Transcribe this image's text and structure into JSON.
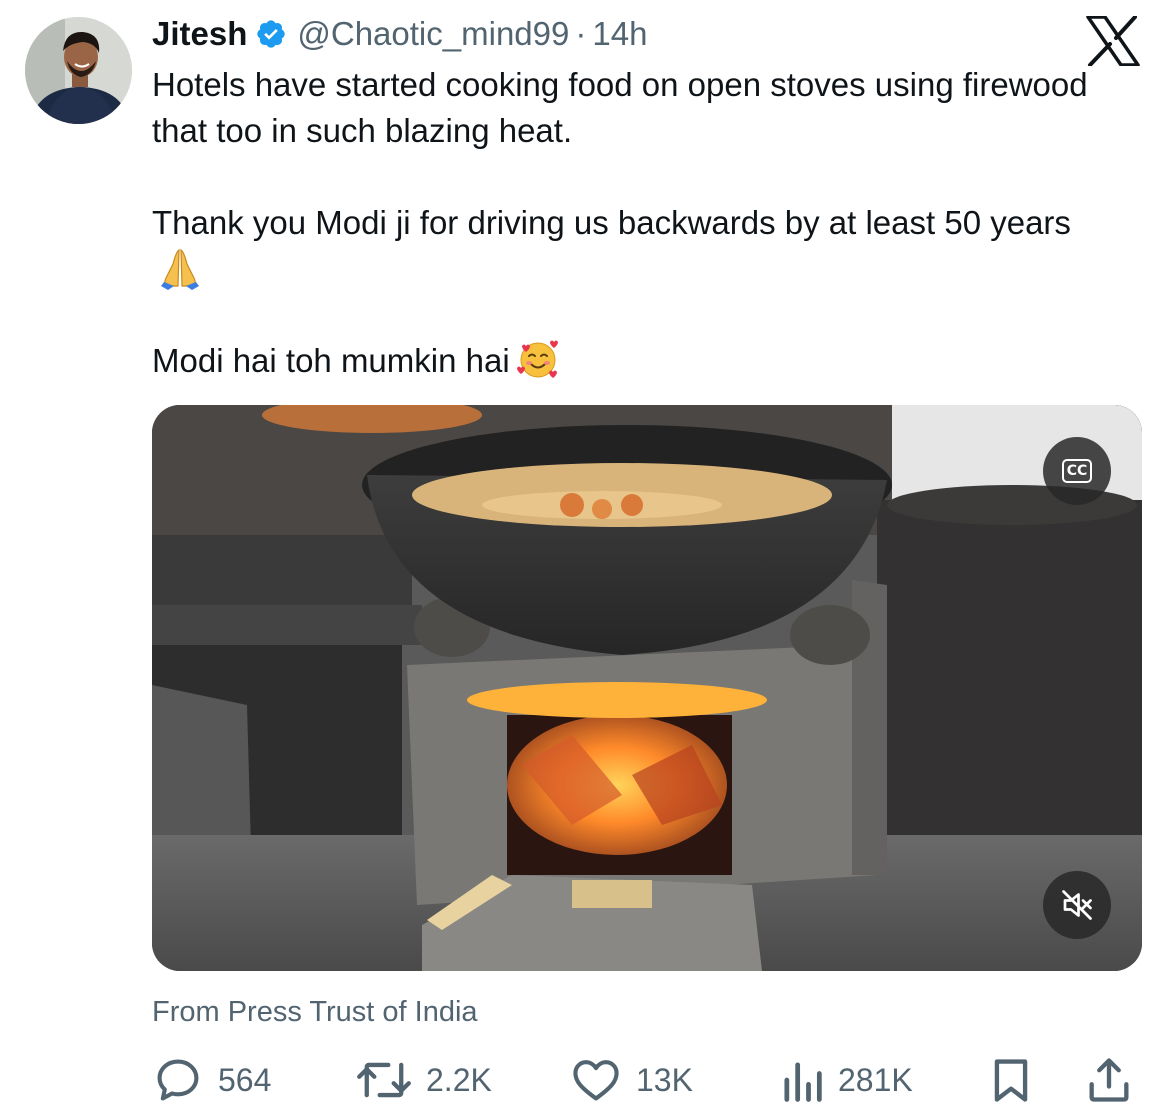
{
  "author": {
    "name": "Jitesh",
    "handle": "@Chaotic_mind99",
    "separator": "·",
    "time": "14h",
    "verified": true
  },
  "platform_logo": "x-logo-icon",
  "tweet": {
    "line1": "Hotels have started cooking food on open stoves using firewood that too in such blazing heat.",
    "line2": "Thank you Modi ji for driving us backwards by at least 50 years",
    "line2_emoji": "folded-hands-emoji",
    "line3": "Modi hai toh mumkin hai",
    "line3_emoji": "smiling-face-with-hearts-emoji"
  },
  "media": {
    "type": "video",
    "captions_label": "CC",
    "mute_icon": "muted-speaker-icon"
  },
  "source": "From Press Trust of India",
  "actions": {
    "replies": "564",
    "reposts": "2.2K",
    "likes": "13K",
    "views": "281K"
  },
  "colors": {
    "text": "#0f1419",
    "secondary": "#536471",
    "verified": "#1d9bf0"
  }
}
